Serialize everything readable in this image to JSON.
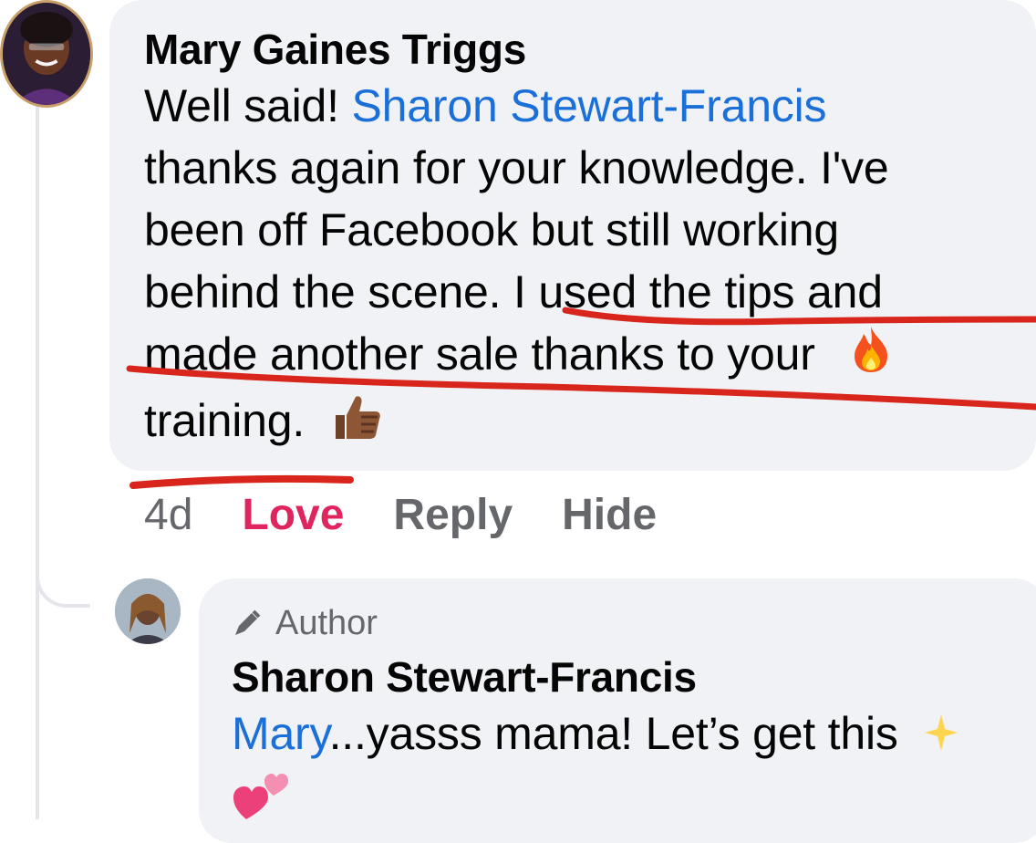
{
  "comment": {
    "author": "Mary Gaines Triggs",
    "text_before_mention": "Well said!  ",
    "mention": "Sharon Stewart-Francis",
    "line2": "thanks again for your knowledge. I've",
    "line3": "been off Facebook but still working",
    "line4": "behind the scene. I used the tips and",
    "line5": "made another sale thanks to your",
    "line6": "training.",
    "emoji_after_line5": "fire-icon",
    "emoji_after_line6": "thumbs-up-icon"
  },
  "actions": {
    "time": "4d",
    "love": "Love",
    "reply": "Reply",
    "hide": "Hide"
  },
  "reply": {
    "badge": "Author",
    "author": "Sharon Stewart-Francis",
    "mention": "Mary",
    "text": "...yasss mama! Let’s get this",
    "emoji_sparkle": "sparkles-icon",
    "emoji_hearts": "two-hearts-icon"
  },
  "colors": {
    "mention": "#1b6fd8",
    "love": "#e0245e",
    "annotation": "#d9261c"
  }
}
